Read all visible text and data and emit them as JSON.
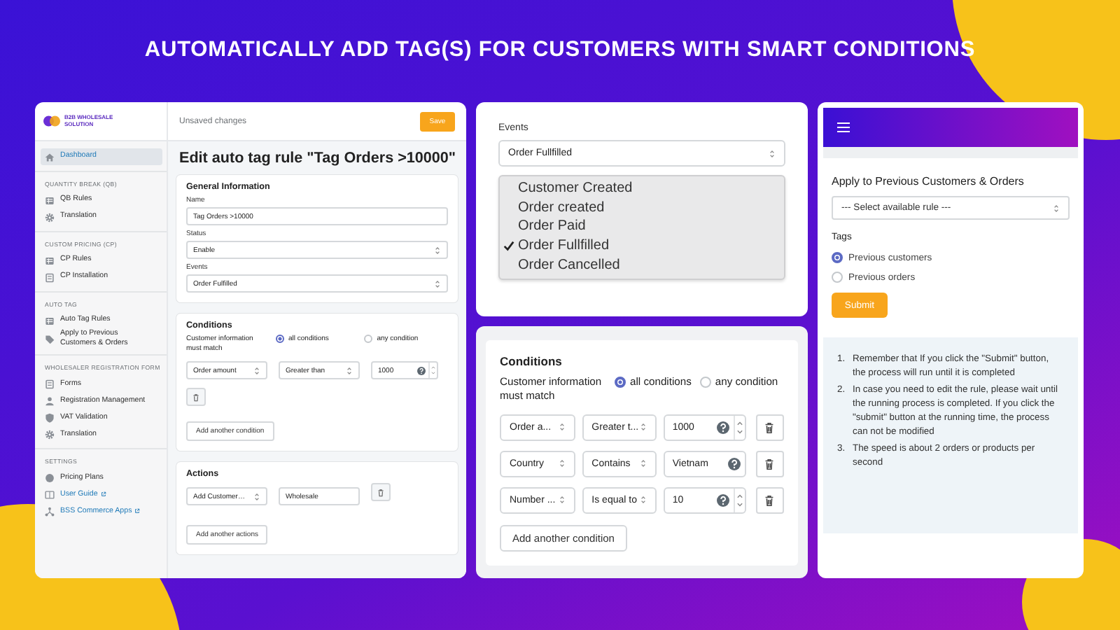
{
  "headline": "AUTOMATICALLY ADD TAG(S) FOR CUSTOMERS WITH SMART CONDITIONS",
  "editor": {
    "logo": "B2B WHOLESALE SOLUTION",
    "status": "Unsaved changes",
    "save_button": "Save",
    "sidebar": [
      {
        "items": [
          {
            "label": "Dashboard",
            "kind": "home",
            "selected": true,
            "external": false
          }
        ]
      },
      {
        "heading": "QUANTITY BREAK (QB)",
        "items": [
          {
            "label": "QB Rules",
            "kind": "list",
            "selected": false,
            "external": false
          },
          {
            "label": "Translation",
            "kind": "gear",
            "selected": false,
            "external": false
          }
        ]
      },
      {
        "heading": "CUSTOM PRICING (CP)",
        "items": [
          {
            "label": "CP Rules",
            "kind": "list",
            "selected": false,
            "external": false
          },
          {
            "label": "CP Installation",
            "kind": "form",
            "selected": false,
            "external": false
          }
        ]
      },
      {
        "heading": "AUTO TAG",
        "items": [
          {
            "label": "Auto Tag Rules",
            "kind": "list",
            "selected": false,
            "external": false
          },
          {
            "label": "Apply to Previous Customers & Orders",
            "kind": "tag",
            "selected": false,
            "external": false
          }
        ]
      },
      {
        "heading": "WHOLESALER REGISTRATION FORM",
        "items": [
          {
            "label": "Forms",
            "kind": "form",
            "selected": false,
            "external": false
          },
          {
            "label": "Registration Management",
            "kind": "person",
            "selected": false,
            "external": false
          },
          {
            "label": "VAT Validation",
            "kind": "shield",
            "selected": false,
            "external": false
          },
          {
            "label": "Translation",
            "kind": "gear",
            "selected": false,
            "external": false
          }
        ]
      },
      {
        "heading": "SETTINGS",
        "items": [
          {
            "label": "Pricing Plans",
            "kind": "coin",
            "selected": false,
            "external": false
          },
          {
            "label": "User Guide",
            "kind": "book",
            "selected": false,
            "external": true
          },
          {
            "label": "BSS Commerce Apps",
            "kind": "network",
            "selected": false,
            "external": true
          }
        ]
      }
    ],
    "title": "Edit auto tag rule \"Tag Orders >10000\"",
    "general": {
      "heading": "General Information",
      "fields": [
        {
          "label": "Name",
          "value": "Tag Orders >10000",
          "kind": "text"
        },
        {
          "label": "Status",
          "value": "Enable",
          "kind": "select"
        },
        {
          "label": "Events",
          "value": "Order Fulfilled",
          "kind": "select"
        }
      ]
    },
    "conditions": {
      "heading": "Conditions",
      "match_label": "Customer information must match",
      "match_options": [
        {
          "label": "all conditions",
          "selected": true
        },
        {
          "label": "any condition",
          "selected": false
        }
      ],
      "rows": [
        {
          "field": "Order amount",
          "operator": "Greater than",
          "value": "1000",
          "stepper": true
        }
      ],
      "add_button": "Add another condition"
    },
    "actions": {
      "heading": "Actions",
      "rows": [
        {
          "action": "Add Customer…",
          "value": "Wholesale"
        }
      ],
      "add_button": "Add another actions"
    }
  },
  "events_panel": {
    "label": "Events",
    "value": "Order Fullfilled",
    "options": [
      {
        "label": "Customer Created",
        "selected": false
      },
      {
        "label": "Order created",
        "selected": false
      },
      {
        "label": "Order Paid",
        "selected": false
      },
      {
        "label": "Order Fullfilled",
        "selected": true
      },
      {
        "label": "Order Cancelled",
        "selected": false
      }
    ]
  },
  "conditions_panel": {
    "heading": "Conditions",
    "match_label": "Customer information must match",
    "match_options": [
      {
        "label": "all conditions",
        "selected": true
      },
      {
        "label": "any condition",
        "selected": false
      }
    ],
    "rows": [
      {
        "field": "Order a...",
        "operator": "Greater t...",
        "value": "1000",
        "stepper": true
      },
      {
        "field": "Country",
        "operator": "Contains",
        "value": "Vietnam",
        "stepper": false
      },
      {
        "field": "Number ...",
        "operator": "Is equal to",
        "value": "10",
        "stepper": true
      }
    ],
    "add_button": "Add another condition"
  },
  "apply_panel": {
    "title": "Apply to Previous Customers & Orders",
    "rule_select": "--- Select available rule ---",
    "tags_label": "Tags",
    "tag_options": [
      {
        "label": "Previous customers",
        "selected": true
      },
      {
        "label": "Previous orders",
        "selected": false
      }
    ],
    "submit_button": "Submit",
    "notes": [
      {
        "number": "1.",
        "text": "Remember that If you click the \"Submit\" button, the process will run until it is completed"
      },
      {
        "number": "2.",
        "text": "In case you need to edit the rule, please wait until the running process is completed. If you click the \"submit\" button at the running time, the process can not be modified"
      },
      {
        "number": "3.",
        "text": "The speed is about 2 orders or products per second"
      }
    ]
  }
}
